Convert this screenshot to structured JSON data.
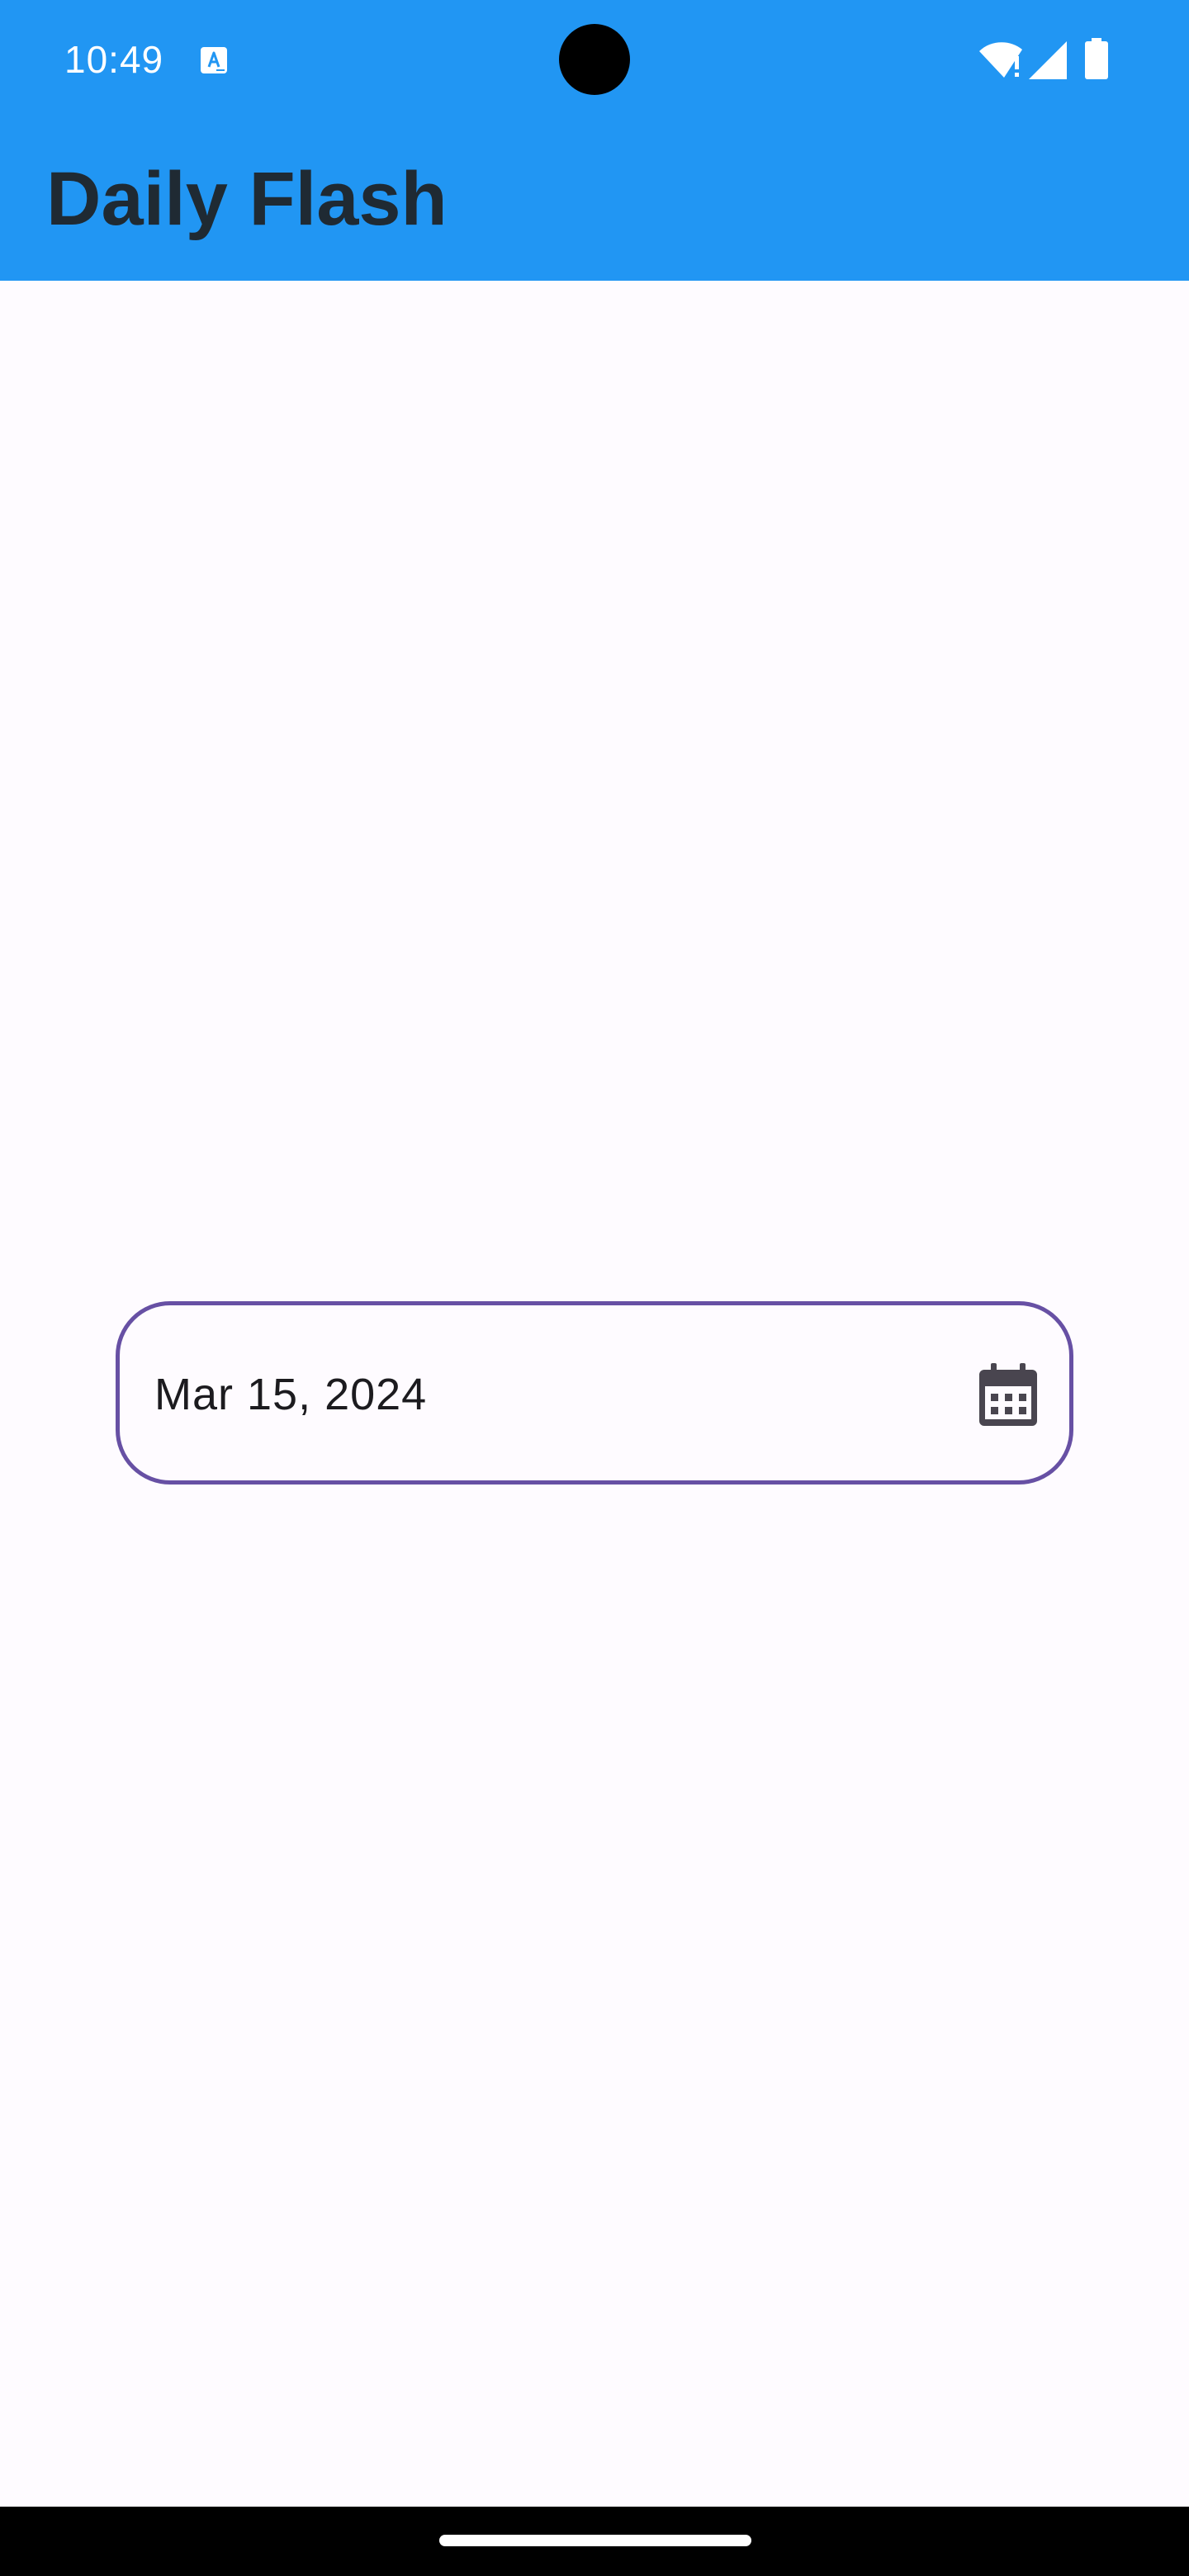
{
  "status_bar": {
    "time": "10:49",
    "app_icon": "translate-icon",
    "wifi_icon": "wifi-alert-icon",
    "signal_icon": "cellular-signal-icon",
    "battery_icon": "battery-full-icon"
  },
  "app_bar": {
    "title": "Daily Flash",
    "background_color": "#2196f3"
  },
  "date_field": {
    "value": "Mar 15, 2024",
    "icon": "calendar-icon",
    "border_color": "#6750a4"
  },
  "navigation": {
    "home_indicator": "home-gesture-bar"
  }
}
